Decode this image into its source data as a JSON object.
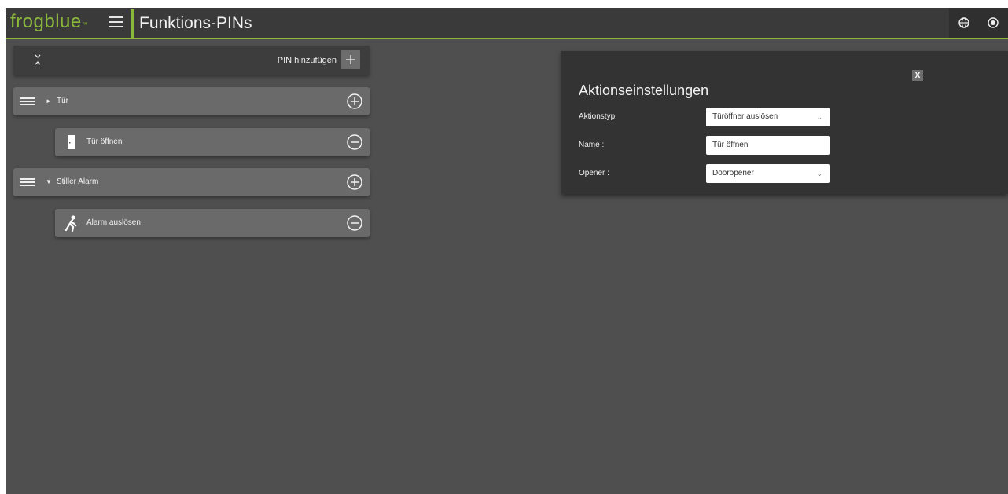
{
  "header": {
    "logo_text": "frogblue",
    "logo_mark": "™",
    "title": "Funktions-PINs",
    "icons": [
      "menu-icon",
      "globe-icon",
      "radio-icon"
    ]
  },
  "toolbar": {
    "collapse_icon": "collapse-all-icon",
    "add_pin_label": "PIN hinzufügen",
    "add_icon": "plus-icon"
  },
  "groups": [
    {
      "label": "Tür",
      "expanded": false,
      "caret": "►",
      "add_icon": "circle-plus-icon",
      "actions": [
        {
          "label": "Tür öffnen",
          "icon": "door-icon",
          "remove_icon": "circle-minus-icon"
        }
      ]
    },
    {
      "label": "Stiller Alarm",
      "expanded": true,
      "caret": "▼",
      "add_icon": "circle-plus-icon",
      "actions": [
        {
          "label": "Alarm auslösen",
          "icon": "alarm-person-icon",
          "remove_icon": "circle-minus-icon"
        }
      ]
    }
  ],
  "settings": {
    "title": "Aktionseinstellungen",
    "close_label": "X",
    "fields": [
      {
        "label": "Aktionstyp",
        "value": "Türöffner auslösen",
        "type": "select"
      },
      {
        "label": "Name :",
        "value": "Tür öffnen",
        "type": "text"
      },
      {
        "label": "Opener :",
        "value": "Dooropener",
        "type": "select"
      }
    ]
  },
  "colors": {
    "accent": "#8cb83a",
    "background": "#4f4f4f",
    "header": "#3a3a3a",
    "row": "#6a6a6a",
    "panel": "#333333"
  }
}
